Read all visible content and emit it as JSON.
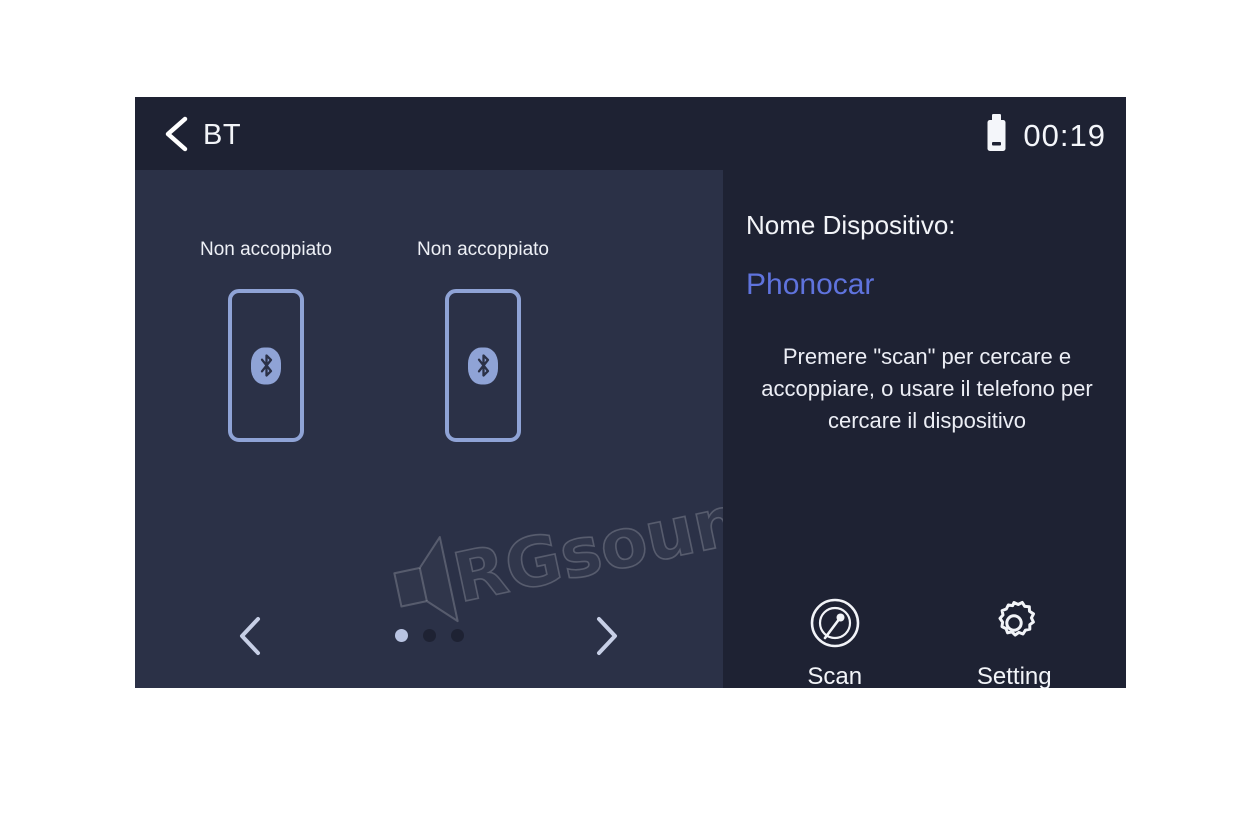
{
  "screen": {
    "statusbar": {
      "back_icon": "chevron-left-icon",
      "title": "BT",
      "usb_icon": "usb-drive-icon",
      "clock": "00:19"
    },
    "device_panel": {
      "devices": [
        {
          "label": "Non accoppiato",
          "icon": "bluetooth-icon"
        },
        {
          "label": "Non accoppiato",
          "icon": "bluetooth-icon"
        }
      ],
      "carousel": {
        "prev_icon": "chevron-left-icon",
        "next_icon": "chevron-right-icon",
        "page_count": 3,
        "active_page": 1
      }
    },
    "info_panel": {
      "device_name_label": "Nome Dispositivo:",
      "device_name_value": "Phonocar",
      "hint": "Premere \"scan\" per cercare e accoppiare, o usare il telefono per cercare il dispositivo",
      "actions": [
        {
          "label": "Scan",
          "icon": "radar-scan-icon"
        },
        {
          "label": "Setting",
          "icon": "gear-icon"
        }
      ]
    }
  },
  "watermark": {
    "text": "RGsound",
    "icon": "speaker-icon"
  },
  "colors": {
    "screen_bg": "#1e2233",
    "device_panel_bg": "#2b3147",
    "accent_blue": "#5f73dd",
    "outline_blue": "#8fa3d6",
    "text_primary": "#f2f4f8"
  }
}
